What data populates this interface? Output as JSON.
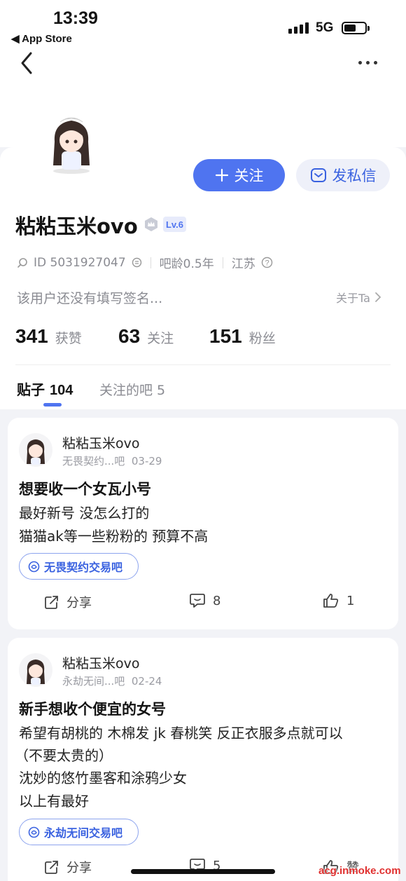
{
  "status_bar": {
    "time": "13:39",
    "back_app": "◀ App Store",
    "network": "5G"
  },
  "header": {
    "back_icon": "chevron-left-icon",
    "more_icon": "more-dots-icon"
  },
  "profile": {
    "follow_label": "关注",
    "message_label": "发私信",
    "username": "粘粘玉米ovo",
    "level": "Lv.6",
    "user_id": "ID 5031927047",
    "bar_age": "吧龄0.5年",
    "location": "江苏",
    "bio": "该用户还没有填写签名...",
    "about_label": "关于Ta",
    "stats": [
      {
        "num": "341",
        "label": "获赞"
      },
      {
        "num": "63",
        "label": "关注"
      },
      {
        "num": "151",
        "label": "粉丝"
      }
    ],
    "tabs": [
      {
        "label": "贴子",
        "count": "104"
      },
      {
        "label": "关注的吧 5"
      }
    ]
  },
  "posts": [
    {
      "author": "粘粘玉米ovo",
      "forum_short": "无畏契约...吧",
      "date": "03-29",
      "title": "想要收一个女瓦小号",
      "lines": [
        "最好新号 没怎么打的",
        "猫猫ak等一些粉粉的 预算不高"
      ],
      "forum_tag": "无畏契约交易吧",
      "share_label": "分享",
      "comments": "8",
      "likes": "1"
    },
    {
      "author": "粘粘玉米ovo",
      "forum_short": "永劫无间...吧",
      "date": "02-24",
      "title": "新手想收个便宜的女号",
      "lines": [
        "希望有胡桃的 木棉发 jk 春桃笑 反正衣服多点就可以",
        "（不要太贵的）",
        "沈妙的悠竹墨客和涂鸦少女",
        "以上有最好"
      ],
      "forum_tag": "永劫无间交易吧",
      "share_label": "分享",
      "comments": "5",
      "likes": "赞"
    }
  ],
  "watermark": "acg.inmoke.com",
  "colors": {
    "accent": "#4f74f0",
    "bg": "#f2f3f7"
  }
}
